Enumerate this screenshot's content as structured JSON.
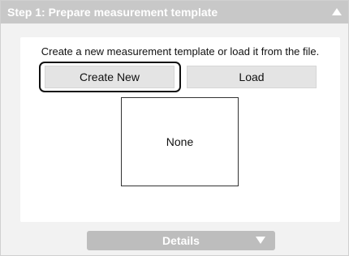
{
  "panel": {
    "title": "Step 1: Prepare measurement template",
    "collapse_icon": "triangle-up-icon"
  },
  "content": {
    "instruction": "Create a new measurement template or load it from the file.",
    "buttons": {
      "create_new": "Create New",
      "load": "Load"
    },
    "focused_button": "Create New",
    "preview_text": "None"
  },
  "footer": {
    "details_label": "Details",
    "details_icon": "triangle-down-icon"
  },
  "colors": {
    "header_bg": "#c8c8c8",
    "panel_bg": "#f2f2f2",
    "button_bg": "#e4e4e4",
    "details_bg": "#bdbdbd"
  }
}
